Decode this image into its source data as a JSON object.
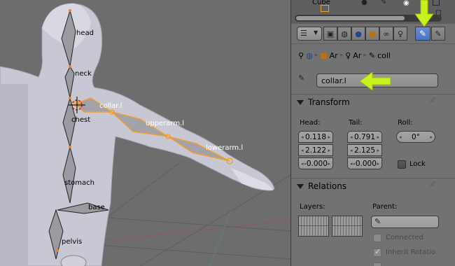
{
  "header": {
    "object_name": "Cube",
    "icons": [
      "sphere-icon",
      "box-icon",
      "cursor-icon",
      "camera-icon",
      "lock-icon"
    ]
  },
  "context_tabs": [
    {
      "name": "render",
      "icon": "camera-icon"
    },
    {
      "name": "scene",
      "icon": "scene-icon"
    },
    {
      "name": "world",
      "icon": "world-icon"
    },
    {
      "name": "object",
      "icon": "cube-icon"
    },
    {
      "name": "constraints",
      "icon": "chain-icon"
    },
    {
      "name": "armature",
      "icon": "stickman-icon"
    },
    {
      "name": "bone",
      "icon": "bone-icon",
      "active": true
    },
    {
      "name": "bone-constraints",
      "icon": "bone-constraint-icon"
    }
  ],
  "breadcrumb": {
    "object": "Ar",
    "armature": "Ar",
    "bone": "coll"
  },
  "bone_name_field": {
    "value": "collar.l"
  },
  "transform": {
    "title": "Transform",
    "head": {
      "label": "Head:",
      "x": "0.118",
      "y": "2.122",
      "z": "-0.000"
    },
    "tail": {
      "label": "Tail:",
      "x": "0.791",
      "y": "2.125",
      "z": "-0.000"
    },
    "roll": {
      "label": "Roll:",
      "value": "0°"
    },
    "lock_label": "Lock"
  },
  "relations": {
    "title": "Relations",
    "layers_label": "Layers:",
    "parent_label": "Parent:",
    "connected_label": "Connected",
    "inherit_rotation_label": "Inherit Rotatio"
  },
  "viewport": {
    "bone_labels": [
      "head",
      "neck",
      "collar.l",
      "chest",
      "upperarm.l",
      "lowerarm.l",
      "stomach",
      "base",
      "pelvis"
    ],
    "selected_bone": "collar.l"
  },
  "colors": {
    "highlight_arrow": "#c7f21d",
    "active_tab": "#5a80cc",
    "selected_bone": "#f0a030"
  }
}
